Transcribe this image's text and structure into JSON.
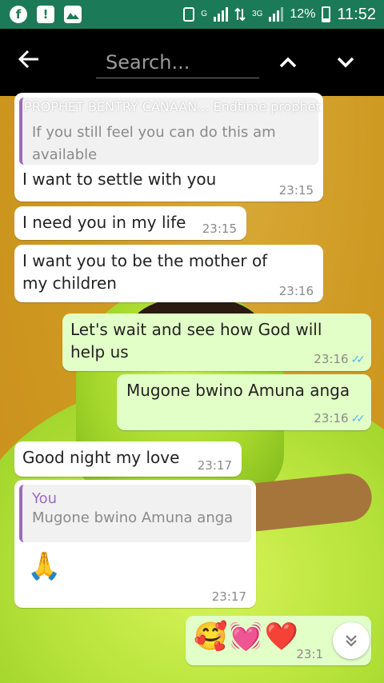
{
  "status_bar": {
    "network_small": "G",
    "network_3g": "3G",
    "battery_percent": "12%",
    "time": "11:52",
    "icons": [
      "facebook-icon",
      "alert-icon",
      "gallery-icon",
      "vibrate-icon",
      "signal-icon",
      "data-transfer-icon",
      "signal-3g-icon",
      "battery-icon"
    ]
  },
  "search": {
    "placeholder": "Search...",
    "icons": [
      "back-arrow-icon",
      "chevron-up-icon",
      "chevron-down-icon"
    ]
  },
  "chat": {
    "header_overlay": "PROPHET BENTRY CANAAN... Endtime prophet",
    "messages": [
      {
        "type": "in",
        "quote_author": "You",
        "quote_text": "If you still feel you can do this am available",
        "text": "I want to settle with you",
        "time": "23:15"
      },
      {
        "type": "in",
        "text": "I need you in my life",
        "time": "23:15"
      },
      {
        "type": "in",
        "text": "I want you to be the mother of my children",
        "time": "23:16"
      },
      {
        "type": "out",
        "text": "Let's wait and see how God will help us",
        "time": "23:16",
        "ticks": "✓✓"
      },
      {
        "type": "out",
        "text": "Mugone bwino Amuna anga",
        "time": "23:16",
        "ticks": "✓✓"
      },
      {
        "type": "in",
        "text": "Good night my love",
        "time": "23:17"
      },
      {
        "type": "in",
        "quote_author": "You",
        "quote_text": "Mugone bwino Amuna anga",
        "text": "🙏",
        "time": "23:17"
      },
      {
        "type": "out",
        "text": "🥰💓❤️",
        "time": "23:1"
      }
    ],
    "scroll_down_icon": "double-chevron-down-icon"
  },
  "colors": {
    "status_bar": "#1b7a57",
    "search_bar": "#000000",
    "incoming_bubble": "#ffffff",
    "outgoing_bubble": "#e2ffc7",
    "quote_accent": "#9c6bbd",
    "read_ticks": "#4fb6ec"
  }
}
